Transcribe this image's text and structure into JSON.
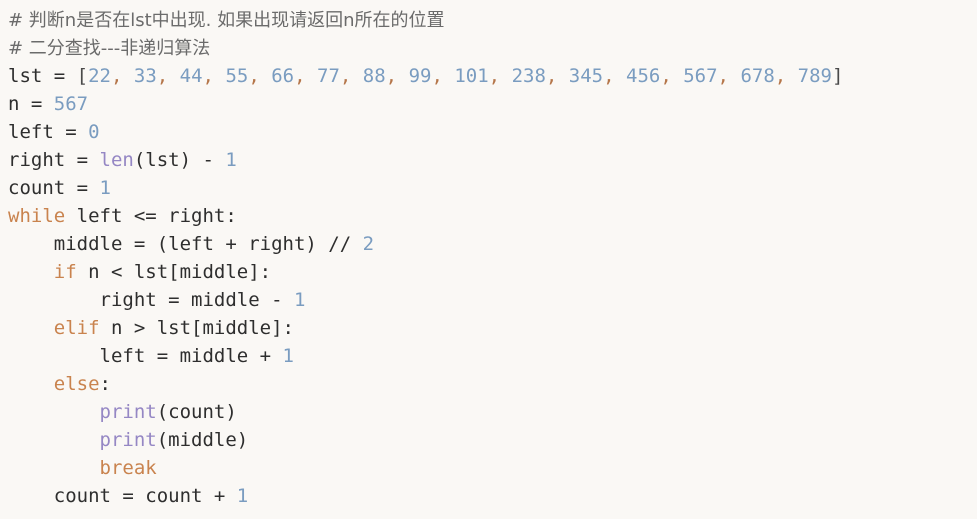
{
  "editor": {
    "language": "python",
    "background_color": "#faf8f5",
    "font_size_px": 19,
    "line_height_px": 28,
    "colors": {
      "text": "#2e2e2e",
      "comment": "#6b6b6b",
      "keyword": "#c9834e",
      "number": "#7a9cc0",
      "builtin": "#9587c4",
      "punctuation": "#4a4a4a",
      "comma": "#b5764a"
    }
  },
  "code": {
    "lines": [
      {
        "index": 1,
        "text": "# 判断n是否在lst中出现. 如果出现请返回n所在的位置",
        "tokens": [
          {
            "t": "# 判断n是否在lst中出现. 如果出现请返回n所在的位置",
            "c": "comment"
          }
        ]
      },
      {
        "index": 2,
        "text": "# 二分查找---非递归算法",
        "tokens": [
          {
            "t": "# 二分查找---非递归算法",
            "c": "comment"
          }
        ]
      },
      {
        "index": 3,
        "text": "lst = [22, 33, 44, 55, 66, 77, 88, 99, 101, 238, 345, 456, 567, 678, 789]",
        "tokens": [
          {
            "t": "lst = ",
            "c": "plain"
          },
          {
            "t": "[",
            "c": "punct"
          },
          {
            "t": "22",
            "c": "number"
          },
          {
            "t": ", ",
            "c": "comma"
          },
          {
            "t": "33",
            "c": "number"
          },
          {
            "t": ", ",
            "c": "comma"
          },
          {
            "t": "44",
            "c": "number"
          },
          {
            "t": ", ",
            "c": "comma"
          },
          {
            "t": "55",
            "c": "number"
          },
          {
            "t": ", ",
            "c": "comma"
          },
          {
            "t": "66",
            "c": "number"
          },
          {
            "t": ", ",
            "c": "comma"
          },
          {
            "t": "77",
            "c": "number"
          },
          {
            "t": ", ",
            "c": "comma"
          },
          {
            "t": "88",
            "c": "number"
          },
          {
            "t": ", ",
            "c": "comma"
          },
          {
            "t": "99",
            "c": "number"
          },
          {
            "t": ", ",
            "c": "comma"
          },
          {
            "t": "101",
            "c": "number"
          },
          {
            "t": ", ",
            "c": "comma"
          },
          {
            "t": "238",
            "c": "number"
          },
          {
            "t": ", ",
            "c": "comma"
          },
          {
            "t": "345",
            "c": "number"
          },
          {
            "t": ", ",
            "c": "comma"
          },
          {
            "t": "456",
            "c": "number"
          },
          {
            "t": ", ",
            "c": "comma"
          },
          {
            "t": "567",
            "c": "number"
          },
          {
            "t": ", ",
            "c": "comma"
          },
          {
            "t": "678",
            "c": "number"
          },
          {
            "t": ", ",
            "c": "comma"
          },
          {
            "t": "789",
            "c": "number"
          },
          {
            "t": "]",
            "c": "punct"
          }
        ]
      },
      {
        "index": 4,
        "text": "n = 567",
        "tokens": [
          {
            "t": "n = ",
            "c": "plain"
          },
          {
            "t": "567",
            "c": "number"
          }
        ]
      },
      {
        "index": 5,
        "text": "left = 0",
        "tokens": [
          {
            "t": "left = ",
            "c": "plain"
          },
          {
            "t": "0",
            "c": "number"
          }
        ]
      },
      {
        "index": 6,
        "text": "right = len(lst) - 1",
        "tokens": [
          {
            "t": "right = ",
            "c": "plain"
          },
          {
            "t": "len",
            "c": "builtin"
          },
          {
            "t": "(lst) - ",
            "c": "plain"
          },
          {
            "t": "1",
            "c": "number"
          }
        ]
      },
      {
        "index": 7,
        "text": "count = 1",
        "tokens": [
          {
            "t": "count = ",
            "c": "plain"
          },
          {
            "t": "1",
            "c": "number"
          }
        ]
      },
      {
        "index": 8,
        "text": "while left <= right:",
        "tokens": [
          {
            "t": "while",
            "c": "keyword"
          },
          {
            "t": " left <= right:",
            "c": "plain"
          }
        ]
      },
      {
        "index": 9,
        "text": "    middle = (left + right) // 2",
        "tokens": [
          {
            "t": "    middle = (left + right) // ",
            "c": "plain"
          },
          {
            "t": "2",
            "c": "number"
          }
        ]
      },
      {
        "index": 10,
        "text": "    if n < lst[middle]:",
        "tokens": [
          {
            "t": "    ",
            "c": "plain"
          },
          {
            "t": "if",
            "c": "keyword"
          },
          {
            "t": " n < lst[middle]:",
            "c": "plain"
          }
        ]
      },
      {
        "index": 11,
        "text": "        right = middle - 1",
        "tokens": [
          {
            "t": "        right = middle - ",
            "c": "plain"
          },
          {
            "t": "1",
            "c": "number"
          }
        ]
      },
      {
        "index": 12,
        "text": "    elif n > lst[middle]:",
        "tokens": [
          {
            "t": "    ",
            "c": "plain"
          },
          {
            "t": "elif",
            "c": "keyword"
          },
          {
            "t": " n > lst[middle]:",
            "c": "plain"
          }
        ]
      },
      {
        "index": 13,
        "text": "        left = middle + 1",
        "tokens": [
          {
            "t": "        left = middle + ",
            "c": "plain"
          },
          {
            "t": "1",
            "c": "number"
          }
        ]
      },
      {
        "index": 14,
        "text": "    else:",
        "tokens": [
          {
            "t": "    ",
            "c": "plain"
          },
          {
            "t": "else",
            "c": "keyword"
          },
          {
            "t": ":",
            "c": "plain"
          }
        ]
      },
      {
        "index": 15,
        "text": "        print(count)",
        "tokens": [
          {
            "t": "        ",
            "c": "plain"
          },
          {
            "t": "print",
            "c": "builtin"
          },
          {
            "t": "(count)",
            "c": "plain"
          }
        ]
      },
      {
        "index": 16,
        "text": "        print(middle)",
        "tokens": [
          {
            "t": "        ",
            "c": "plain"
          },
          {
            "t": "print",
            "c": "builtin"
          },
          {
            "t": "(middle)",
            "c": "plain"
          }
        ]
      },
      {
        "index": 17,
        "text": "        break",
        "tokens": [
          {
            "t": "        ",
            "c": "plain"
          },
          {
            "t": "break",
            "c": "keyword"
          }
        ]
      },
      {
        "index": 18,
        "text": "    count = count + 1",
        "tokens": [
          {
            "t": "    count = count + ",
            "c": "plain"
          },
          {
            "t": "1",
            "c": "number"
          }
        ]
      }
    ]
  }
}
